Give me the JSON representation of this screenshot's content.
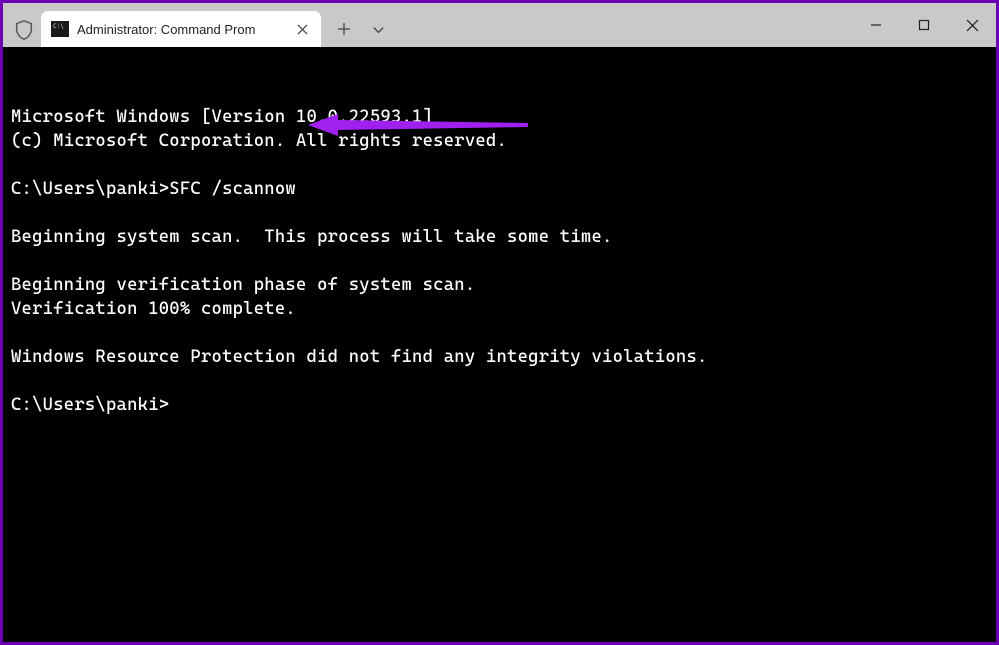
{
  "tab": {
    "title": "Administrator: Command Prom"
  },
  "terminal": {
    "lines": [
      "Microsoft Windows [Version 10.0.22593.1]",
      "(c) Microsoft Corporation. All rights reserved.",
      "",
      "C:\\Users\\panki>SFC /scannow",
      "",
      "Beginning system scan.  This process will take some time.",
      "",
      "Beginning verification phase of system scan.",
      "Verification 100% complete.",
      "",
      "Windows Resource Protection did not find any integrity violations.",
      "",
      "C:\\Users\\panki>"
    ]
  },
  "colors": {
    "arrow": "#a020f0"
  }
}
